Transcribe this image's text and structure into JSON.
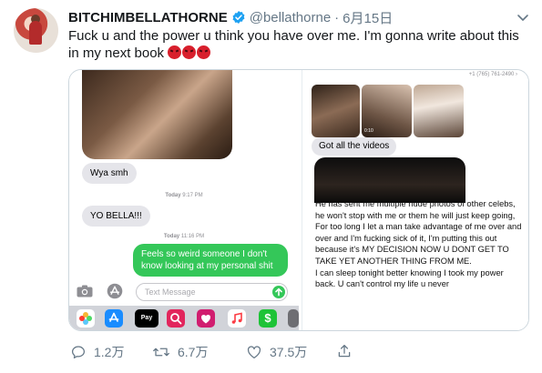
{
  "tweet": {
    "display_name": "BITCHIMBELLATHORNE",
    "handle": "@bellathorne",
    "separator": "·",
    "time": "6月15日",
    "text": "Fuck u and the power u think you have over me. I'm gonna write about this in my next book",
    "emoji_icons": [
      "angry-face-icon",
      "angry-face-icon",
      "angry-face-icon"
    ]
  },
  "left_screenshot": {
    "messages": [
      {
        "from": "them",
        "text": "Wya smh"
      },
      {
        "from": "them",
        "text": "YO BELLA!!!"
      },
      {
        "from": "me",
        "text": "Feels so weird someone I don't know looking at my personal shit"
      }
    ],
    "stamps": [
      {
        "day": "Today",
        "time": "9:17 PM"
      },
      {
        "day": "Today",
        "time": "11:16 PM"
      }
    ],
    "input_placeholder": "Text Message",
    "apps": [
      {
        "icon": "photos-icon",
        "color": "#ffffff"
      },
      {
        "icon": "app-store-icon",
        "color": "#1a8cff"
      },
      {
        "icon": "apple-pay-icon",
        "label": "Pay",
        "color": "#000000"
      },
      {
        "icon": "search-images-icon",
        "color": "#e2255c"
      },
      {
        "icon": "heart-sticker-icon",
        "color": "#d11d6f"
      },
      {
        "icon": "music-icon",
        "color": "#ffffff"
      },
      {
        "icon": "cash-app-icon",
        "label": "$",
        "color": "#1ec337"
      },
      {
        "icon": "more-apps-icon",
        "color": "#6e6e73"
      }
    ]
  },
  "right_screenshot": {
    "phone_number": "+1 (765) 761-2490 ›",
    "video_time": "0:10",
    "message": "Got all the videos",
    "statement": "He has sent me multiple nude photos of other celebs, he won't stop with me or them he will just keep going,\nFor too long I let a man take advantage of me over and over and I'm fucking sick of it, I'm putting this out because it's MY DECISION NOW U DONT GET TO TAKE YET ANOTHER THING FROM ME.\nI can sleep tonight better knowing I took my power back. U can't control my life u never"
  },
  "actions": {
    "reply_count": "1.2万",
    "retweet_count": "6.7万",
    "like_count": "37.5万"
  },
  "colors": {
    "verified": "#1da1f2",
    "muted": "#657786",
    "imessage_green": "#34c759"
  }
}
